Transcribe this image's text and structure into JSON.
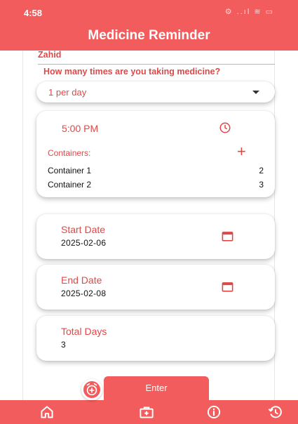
{
  "status_bar": {
    "time": "4:58",
    "icons": "⚙ ..ıl ≋ ▭"
  },
  "app": {
    "title": "Medicine Reminder"
  },
  "form": {
    "name_value": "Zahid",
    "frequency_question": "How many times are you taking medicine?",
    "frequency_selected": "1 per day",
    "dose_time": "5:00 PM",
    "containers_label": "Containers:",
    "containers": [
      {
        "name": "Container 1",
        "count": "2"
      },
      {
        "name": "Container 2",
        "count": "3"
      }
    ],
    "start_date_label": "Start Date",
    "start_date": "2025-02-06",
    "end_date_label": "End Date",
    "end_date": "2025-02-08",
    "total_days_label": "Total Days",
    "total_days": "3"
  },
  "actions": {
    "enter_label": "Enter"
  },
  "bottom_nav": {
    "items": [
      "home-icon",
      "add-alarm-icon",
      "medical-kit-icon",
      "info-icon",
      "history-icon"
    ]
  },
  "colors": {
    "accent": "#f25c5c",
    "text_accent": "#e04848"
  }
}
